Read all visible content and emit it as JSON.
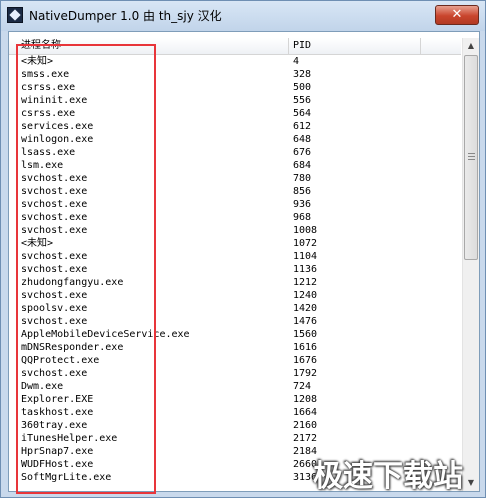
{
  "window": {
    "title": "NativeDumper 1.0 由 th_sjy 汉化",
    "close_label": "✕"
  },
  "table": {
    "columns": [
      "进程名称",
      "PID"
    ],
    "rows": [
      {
        "name": "<未知>",
        "pid": "4"
      },
      {
        "name": "smss.exe",
        "pid": "328"
      },
      {
        "name": "csrss.exe",
        "pid": "500"
      },
      {
        "name": "wininit.exe",
        "pid": "556"
      },
      {
        "name": "csrss.exe",
        "pid": "564"
      },
      {
        "name": "services.exe",
        "pid": "612"
      },
      {
        "name": "winlogon.exe",
        "pid": "648"
      },
      {
        "name": "lsass.exe",
        "pid": "676"
      },
      {
        "name": "lsm.exe",
        "pid": "684"
      },
      {
        "name": "svchost.exe",
        "pid": "780"
      },
      {
        "name": "svchost.exe",
        "pid": "856"
      },
      {
        "name": "svchost.exe",
        "pid": "936"
      },
      {
        "name": "svchost.exe",
        "pid": "968"
      },
      {
        "name": "svchost.exe",
        "pid": "1008"
      },
      {
        "name": "<未知>",
        "pid": "1072"
      },
      {
        "name": "svchost.exe",
        "pid": "1104"
      },
      {
        "name": "svchost.exe",
        "pid": "1136"
      },
      {
        "name": "zhudongfangyu.exe",
        "pid": "1212"
      },
      {
        "name": "svchost.exe",
        "pid": "1240"
      },
      {
        "name": "spoolsv.exe",
        "pid": "1420"
      },
      {
        "name": "svchost.exe",
        "pid": "1476"
      },
      {
        "name": "AppleMobileDeviceService.exe",
        "pid": "1560"
      },
      {
        "name": "mDNSResponder.exe",
        "pid": "1616"
      },
      {
        "name": "QQProtect.exe",
        "pid": "1676"
      },
      {
        "name": "svchost.exe",
        "pid": "1792"
      },
      {
        "name": "Dwm.exe",
        "pid": "724"
      },
      {
        "name": "Explorer.EXE",
        "pid": "1208"
      },
      {
        "name": "taskhost.exe",
        "pid": "1664"
      },
      {
        "name": "360tray.exe",
        "pid": "2160"
      },
      {
        "name": "iTunesHelper.exe",
        "pid": "2172"
      },
      {
        "name": "HprSnap7.exe",
        "pid": "2184"
      },
      {
        "name": "WUDFHost.exe",
        "pid": "2660"
      },
      {
        "name": "SoftMgrLite.exe",
        "pid": "3136"
      }
    ]
  },
  "scrollbar": {
    "up_icon": "scroll-up-arrow",
    "down_icon": "scroll-down-arrow"
  },
  "watermark": "极速下载站",
  "colors": {
    "highlight": "#e8353a",
    "title_bar": "#c9d9ec",
    "close_button": "#c9452d"
  }
}
